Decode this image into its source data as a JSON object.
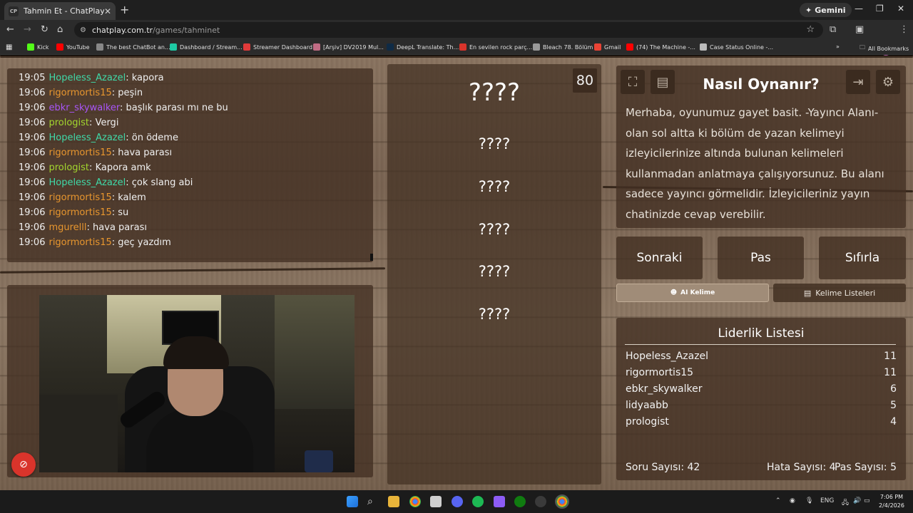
{
  "browser": {
    "tab_title": "Tahmin Et - ChatPlay",
    "tab_favicon": "CP",
    "gemini_label": "Gemini",
    "url_host": "chatplay.com.tr",
    "url_path": "/games/tahminet",
    "bookmarks": [
      {
        "label": "Kick",
        "color": "#53fc18"
      },
      {
        "label": "YouTube",
        "color": "#ff0000"
      },
      {
        "label": "The best ChatBot an...",
        "color": "#888888"
      },
      {
        "label": "Dashboard / Stream...",
        "color": "#1ec9a4"
      },
      {
        "label": "Streamer Dashboard",
        "color": "#e03a3a"
      },
      {
        "label": "[Arşiv] DV2019 Mul...",
        "color": "#c06c84"
      },
      {
        "label": "DeepL Translate: Th...",
        "color": "#0f2b46"
      },
      {
        "label": "En sevilen rock parç...",
        "color": "#d9342b"
      },
      {
        "label": "Bleach 78. Bölüm",
        "color": "#9a9a9a"
      },
      {
        "label": "Gmail",
        "color": "#ea4335"
      },
      {
        "label": "(74) The Machine -...",
        "color": "#ff0000"
      },
      {
        "label": "Case Status Online -...",
        "color": "#bbbbbb"
      }
    ],
    "all_bookmarks_label": "All Bookmarks"
  },
  "chat": {
    "messages": [
      {
        "time": "19:05",
        "user": "Hopeless_Azazel",
        "color": "#3fd9a8",
        "text": "kapora"
      },
      {
        "time": "19:06",
        "user": "rigormortis15",
        "color": "#e8962e",
        "text": "peşin"
      },
      {
        "time": "19:06",
        "user": "ebkr_skywalker",
        "color": "#a855f7",
        "text": "başlık parası mı ne bu"
      },
      {
        "time": "19:06",
        "user": "prologist",
        "color": "#a3d62e",
        "text": "Vergi"
      },
      {
        "time": "19:06",
        "user": "Hopeless_Azazel",
        "color": "#3fd9a8",
        "text": "ön ödeme"
      },
      {
        "time": "19:06",
        "user": "rigormortis15",
        "color": "#e8962e",
        "text": "hava parası"
      },
      {
        "time": "19:06",
        "user": "prologist",
        "color": "#a3d62e",
        "text": "Kapora amk"
      },
      {
        "time": "19:06",
        "user": "Hopeless_Azazel",
        "color": "#3fd9a8",
        "text": "çok slang abi"
      },
      {
        "time": "19:06",
        "user": "rigormortis15",
        "color": "#e8962e",
        "text": "kalem"
      },
      {
        "time": "19:06",
        "user": "rigormortis15",
        "color": "#e8962e",
        "text": "su"
      },
      {
        "time": "19:06",
        "user": "mgurelll",
        "color": "#e8962e",
        "text": "hava parası"
      },
      {
        "time": "19:06",
        "user": "rigormortis15",
        "color": "#e8962e",
        "text": "geç yazdım"
      }
    ]
  },
  "game": {
    "timer": "80",
    "words": [
      "????",
      "????",
      "????",
      "????",
      "????",
      "????"
    ]
  },
  "howto": {
    "title": "Nasıl Oynanır?",
    "text": "Merhaba, oyunumuz gayet basit. -Yayıncı Alanı- olan sol altta ki bölüm de yazan kelimeyi izleyicilerinize altında bulunan kelimeleri kullanmadan anlatmaya çalışıyorsunuz. Bu alanı sadece yayıncı görmelidir. İzleyicileriniz yayın chatinizde cevap verebilir."
  },
  "controls": {
    "next": "Sonraki",
    "pass": "Pas",
    "reset": "Sıfırla",
    "ai_word": "AI Kelime",
    "word_lists": "Kelime Listeleri"
  },
  "leaderboard": {
    "title": "Liderlik Listesi",
    "rows": [
      {
        "name": "Hopeless_Azazel",
        "score": "11"
      },
      {
        "name": "rigormortis15",
        "score": "11"
      },
      {
        "name": "ebkr_skywalker",
        "score": "6"
      },
      {
        "name": "lidyaabb",
        "score": "5"
      },
      {
        "name": "prologist",
        "score": "4"
      }
    ],
    "question_count": "Soru Sayısı: 42",
    "error_count": "Hata Sayısı: 4",
    "pass_count": "Pas Sayısı: 5"
  },
  "taskbar": {
    "lang": "ENG",
    "time": "7:06 PM",
    "date": "2/4/2026"
  }
}
